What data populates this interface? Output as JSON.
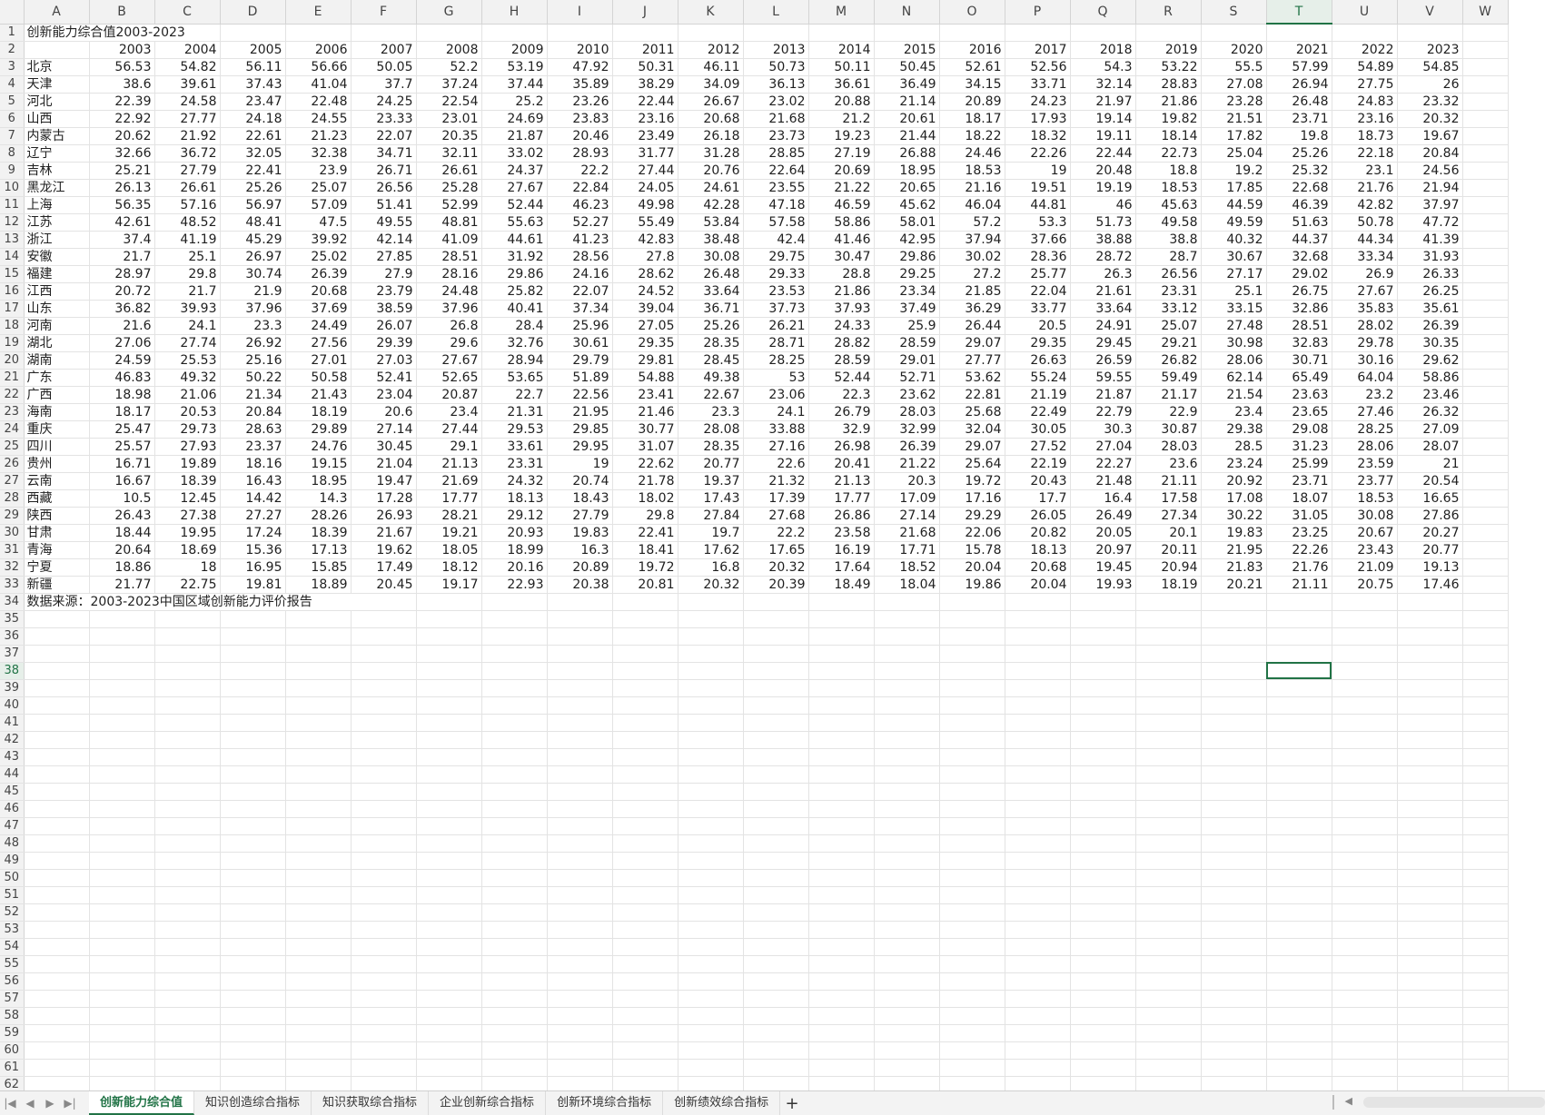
{
  "columns": [
    "A",
    "B",
    "C",
    "D",
    "E",
    "F",
    "G",
    "H",
    "I",
    "J",
    "K",
    "L",
    "M",
    "N",
    "O",
    "P",
    "Q",
    "R",
    "S",
    "T",
    "U",
    "V",
    "W"
  ],
  "active_column": "T",
  "active_row": 38,
  "title": "创新能力综合值2003-2023",
  "years": [
    "2003",
    "2004",
    "2005",
    "2006",
    "2007",
    "2008",
    "2009",
    "2010",
    "2011",
    "2012",
    "2013",
    "2014",
    "2015",
    "2016",
    "2017",
    "2018",
    "2019",
    "2020",
    "2021",
    "2022",
    "2023"
  ],
  "rows": [
    {
      "name": "北京",
      "values": [
        "56.53",
        "54.82",
        "56.11",
        "56.66",
        "50.05",
        "52.2",
        "53.19",
        "47.92",
        "50.31",
        "46.11",
        "50.73",
        "50.11",
        "50.45",
        "52.61",
        "52.56",
        "54.3",
        "53.22",
        "55.5",
        "57.99",
        "54.89",
        "54.85"
      ]
    },
    {
      "name": "天津",
      "values": [
        "38.6",
        "39.61",
        "37.43",
        "41.04",
        "37.7",
        "37.24",
        "37.44",
        "35.89",
        "38.29",
        "34.09",
        "36.13",
        "36.61",
        "36.49",
        "34.15",
        "33.71",
        "32.14",
        "28.83",
        "27.08",
        "26.94",
        "27.75",
        "26"
      ]
    },
    {
      "name": "河北",
      "values": [
        "22.39",
        "24.58",
        "23.47",
        "22.48",
        "24.25",
        "22.54",
        "25.2",
        "23.26",
        "22.44",
        "26.67",
        "23.02",
        "20.88",
        "21.14",
        "20.89",
        "24.23",
        "21.97",
        "21.86",
        "23.28",
        "26.48",
        "24.83",
        "23.32"
      ]
    },
    {
      "name": "山西",
      "values": [
        "22.92",
        "27.77",
        "24.18",
        "24.55",
        "23.33",
        "23.01",
        "24.69",
        "23.83",
        "23.16",
        "20.68",
        "21.68",
        "21.2",
        "20.61",
        "18.17",
        "17.93",
        "19.14",
        "19.82",
        "21.51",
        "23.71",
        "23.16",
        "20.32"
      ]
    },
    {
      "name": "内蒙古",
      "values": [
        "20.62",
        "21.92",
        "22.61",
        "21.23",
        "22.07",
        "20.35",
        "21.87",
        "20.46",
        "23.49",
        "26.18",
        "23.73",
        "19.23",
        "21.44",
        "18.22",
        "18.32",
        "19.11",
        "18.14",
        "17.82",
        "19.8",
        "18.73",
        "19.67"
      ]
    },
    {
      "name": "辽宁",
      "values": [
        "32.66",
        "36.72",
        "32.05",
        "32.38",
        "34.71",
        "32.11",
        "33.02",
        "28.93",
        "31.77",
        "31.28",
        "28.85",
        "27.19",
        "26.88",
        "24.46",
        "22.26",
        "22.44",
        "22.73",
        "25.04",
        "25.26",
        "22.18",
        "20.84"
      ]
    },
    {
      "name": "吉林",
      "values": [
        "25.21",
        "27.79",
        "22.41",
        "23.9",
        "26.71",
        "26.61",
        "24.37",
        "22.2",
        "27.44",
        "20.76",
        "22.64",
        "20.69",
        "18.95",
        "18.53",
        "19",
        "20.48",
        "18.8",
        "19.2",
        "25.32",
        "23.1",
        "24.56"
      ]
    },
    {
      "name": "黑龙江",
      "values": [
        "26.13",
        "26.61",
        "25.26",
        "25.07",
        "26.56",
        "25.28",
        "27.67",
        "22.84",
        "24.05",
        "24.61",
        "23.55",
        "21.22",
        "20.65",
        "21.16",
        "19.51",
        "19.19",
        "18.53",
        "17.85",
        "22.68",
        "21.76",
        "21.94"
      ]
    },
    {
      "name": "上海",
      "values": [
        "56.35",
        "57.16",
        "56.97",
        "57.09",
        "51.41",
        "52.99",
        "52.44",
        "46.23",
        "49.98",
        "42.28",
        "47.18",
        "46.59",
        "45.62",
        "46.04",
        "44.81",
        "46",
        "45.63",
        "44.59",
        "46.39",
        "42.82",
        "37.97"
      ]
    },
    {
      "name": "江苏",
      "values": [
        "42.61",
        "48.52",
        "48.41",
        "47.5",
        "49.55",
        "48.81",
        "55.63",
        "52.27",
        "55.49",
        "53.84",
        "57.58",
        "58.86",
        "58.01",
        "57.2",
        "53.3",
        "51.73",
        "49.58",
        "49.59",
        "51.63",
        "50.78",
        "47.72"
      ]
    },
    {
      "name": "浙江",
      "values": [
        "37.4",
        "41.19",
        "45.29",
        "39.92",
        "42.14",
        "41.09",
        "44.61",
        "41.23",
        "42.83",
        "38.48",
        "42.4",
        "41.46",
        "42.95",
        "37.94",
        "37.66",
        "38.88",
        "38.8",
        "40.32",
        "44.37",
        "44.34",
        "41.39"
      ]
    },
    {
      "name": "安徽",
      "values": [
        "21.7",
        "25.1",
        "26.97",
        "25.02",
        "27.85",
        "28.51",
        "31.92",
        "28.56",
        "27.8",
        "30.08",
        "29.75",
        "30.47",
        "29.86",
        "30.02",
        "28.36",
        "28.72",
        "28.7",
        "30.67",
        "32.68",
        "33.34",
        "31.93"
      ]
    },
    {
      "name": "福建",
      "values": [
        "28.97",
        "29.8",
        "30.74",
        "26.39",
        "27.9",
        "28.16",
        "29.86",
        "24.16",
        "28.62",
        "26.48",
        "29.33",
        "28.8",
        "29.25",
        "27.2",
        "25.77",
        "26.3",
        "26.56",
        "27.17",
        "29.02",
        "26.9",
        "26.33"
      ]
    },
    {
      "name": "江西",
      "values": [
        "20.72",
        "21.7",
        "21.9",
        "20.68",
        "23.79",
        "24.48",
        "25.82",
        "22.07",
        "24.52",
        "33.64",
        "23.53",
        "21.86",
        "23.34",
        "21.85",
        "22.04",
        "21.61",
        "23.31",
        "25.1",
        "26.75",
        "27.67",
        "26.25"
      ]
    },
    {
      "name": "山东",
      "values": [
        "36.82",
        "39.93",
        "37.96",
        "37.69",
        "38.59",
        "37.96",
        "40.41",
        "37.34",
        "39.04",
        "36.71",
        "37.73",
        "37.93",
        "37.49",
        "36.29",
        "33.77",
        "33.64",
        "33.12",
        "33.15",
        "32.86",
        "35.83",
        "35.61"
      ]
    },
    {
      "name": "河南",
      "values": [
        "21.6",
        "24.1",
        "23.3",
        "24.49",
        "26.07",
        "26.8",
        "28.4",
        "25.96",
        "27.05",
        "25.26",
        "26.21",
        "24.33",
        "25.9",
        "26.44",
        "20.5",
        "24.91",
        "25.07",
        "27.48",
        "28.51",
        "28.02",
        "26.39"
      ]
    },
    {
      "name": "湖北",
      "values": [
        "27.06",
        "27.74",
        "26.92",
        "27.56",
        "29.39",
        "29.6",
        "32.76",
        "30.61",
        "29.35",
        "28.35",
        "28.71",
        "28.82",
        "28.59",
        "29.07",
        "29.35",
        "29.45",
        "29.21",
        "30.98",
        "32.83",
        "29.78",
        "30.35"
      ]
    },
    {
      "name": "湖南",
      "values": [
        "24.59",
        "25.53",
        "25.16",
        "27.01",
        "27.03",
        "27.67",
        "28.94",
        "29.79",
        "29.81",
        "28.45",
        "28.25",
        "28.59",
        "29.01",
        "27.77",
        "26.63",
        "26.59",
        "26.82",
        "28.06",
        "30.71",
        "30.16",
        "29.62"
      ]
    },
    {
      "name": "广东",
      "values": [
        "46.83",
        "49.32",
        "50.22",
        "50.58",
        "52.41",
        "52.65",
        "53.65",
        "51.89",
        "54.88",
        "49.38",
        "53",
        "52.44",
        "52.71",
        "53.62",
        "55.24",
        "59.55",
        "59.49",
        "62.14",
        "65.49",
        "64.04",
        "58.86"
      ]
    },
    {
      "name": "广西",
      "values": [
        "18.98",
        "21.06",
        "21.34",
        "21.43",
        "23.04",
        "20.87",
        "22.7",
        "22.56",
        "23.41",
        "22.67",
        "23.06",
        "22.3",
        "23.62",
        "22.81",
        "21.19",
        "21.87",
        "21.17",
        "21.54",
        "23.63",
        "23.2",
        "23.46"
      ]
    },
    {
      "name": "海南",
      "values": [
        "18.17",
        "20.53",
        "20.84",
        "18.19",
        "20.6",
        "23.4",
        "21.31",
        "21.95",
        "21.46",
        "23.3",
        "24.1",
        "26.79",
        "28.03",
        "25.68",
        "22.49",
        "22.79",
        "22.9",
        "23.4",
        "23.65",
        "27.46",
        "26.32"
      ]
    },
    {
      "name": "重庆",
      "values": [
        "25.47",
        "29.73",
        "28.63",
        "29.89",
        "27.14",
        "27.44",
        "29.53",
        "29.85",
        "30.77",
        "28.08",
        "33.88",
        "32.9",
        "32.99",
        "32.04",
        "30.05",
        "30.3",
        "30.87",
        "29.38",
        "29.08",
        "28.25",
        "27.09"
      ]
    },
    {
      "name": "四川",
      "values": [
        "25.57",
        "27.93",
        "23.37",
        "24.76",
        "30.45",
        "29.1",
        "33.61",
        "29.95",
        "31.07",
        "28.35",
        "27.16",
        "26.98",
        "26.39",
        "29.07",
        "27.52",
        "27.04",
        "28.03",
        "28.5",
        "31.23",
        "28.06",
        "28.07"
      ]
    },
    {
      "name": "贵州",
      "values": [
        "16.71",
        "19.89",
        "18.16",
        "19.15",
        "21.04",
        "21.13",
        "23.31",
        "19",
        "22.62",
        "20.77",
        "22.6",
        "20.41",
        "21.22",
        "25.64",
        "22.19",
        "22.27",
        "23.6",
        "23.24",
        "25.99",
        "23.59",
        "21"
      ]
    },
    {
      "name": "云南",
      "values": [
        "16.67",
        "18.39",
        "16.43",
        "18.95",
        "19.47",
        "21.69",
        "24.32",
        "20.74",
        "21.78",
        "19.37",
        "21.32",
        "21.13",
        "20.3",
        "19.72",
        "20.43",
        "21.48",
        "21.11",
        "20.92",
        "23.71",
        "23.77",
        "20.54"
      ]
    },
    {
      "name": "西藏",
      "values": [
        "10.5",
        "12.45",
        "14.42",
        "14.3",
        "17.28",
        "17.77",
        "18.13",
        "18.43",
        "18.02",
        "17.43",
        "17.39",
        "17.77",
        "17.09",
        "17.16",
        "17.7",
        "16.4",
        "17.58",
        "17.08",
        "18.07",
        "18.53",
        "16.65"
      ]
    },
    {
      "name": "陕西",
      "values": [
        "26.43",
        "27.38",
        "27.27",
        "28.26",
        "26.93",
        "28.21",
        "29.12",
        "27.79",
        "29.8",
        "27.84",
        "27.68",
        "26.86",
        "27.14",
        "29.29",
        "26.05",
        "26.49",
        "27.34",
        "30.22",
        "31.05",
        "30.08",
        "27.86"
      ]
    },
    {
      "name": "甘肃",
      "values": [
        "18.44",
        "19.95",
        "17.24",
        "18.39",
        "21.67",
        "19.21",
        "20.93",
        "19.83",
        "22.41",
        "19.7",
        "22.2",
        "23.58",
        "21.68",
        "22.06",
        "20.82",
        "20.05",
        "20.1",
        "19.83",
        "23.25",
        "20.67",
        "20.27"
      ]
    },
    {
      "name": "青海",
      "values": [
        "20.64",
        "18.69",
        "15.36",
        "17.13",
        "19.62",
        "18.05",
        "18.99",
        "16.3",
        "18.41",
        "17.62",
        "17.65",
        "16.19",
        "17.71",
        "15.78",
        "18.13",
        "20.97",
        "20.11",
        "21.95",
        "22.26",
        "23.43",
        "20.77"
      ]
    },
    {
      "name": "宁夏",
      "values": [
        "18.86",
        "18",
        "16.95",
        "15.85",
        "17.49",
        "18.12",
        "20.16",
        "20.89",
        "19.72",
        "16.8",
        "20.32",
        "17.64",
        "18.52",
        "20.04",
        "20.68",
        "19.45",
        "20.94",
        "21.83",
        "21.76",
        "21.09",
        "19.13"
      ]
    },
    {
      "name": "新疆",
      "values": [
        "21.77",
        "22.75",
        "19.81",
        "18.89",
        "20.45",
        "19.17",
        "22.93",
        "20.38",
        "20.81",
        "20.32",
        "20.39",
        "18.49",
        "18.04",
        "19.86",
        "20.04",
        "19.93",
        "18.19",
        "20.21",
        "21.11",
        "20.75",
        "17.46"
      ]
    }
  ],
  "source_note": "数据来源：2003-2023中国区域创新能力评价报告",
  "total_rows": 62,
  "tabs": [
    {
      "label": "创新能力综合值",
      "active": true
    },
    {
      "label": "知识创造综合指标",
      "active": false
    },
    {
      "label": "知识获取综合指标",
      "active": false
    },
    {
      "label": "企业创新综合指标",
      "active": false
    },
    {
      "label": "创新环境综合指标",
      "active": false
    },
    {
      "label": "创新绩效综合指标",
      "active": false
    }
  ],
  "nav_icons": [
    "first-sheet-icon",
    "prev-sheet-icon",
    "next-sheet-icon",
    "last-sheet-icon"
  ],
  "add_tab_label": "+",
  "accent_color": "#217346"
}
